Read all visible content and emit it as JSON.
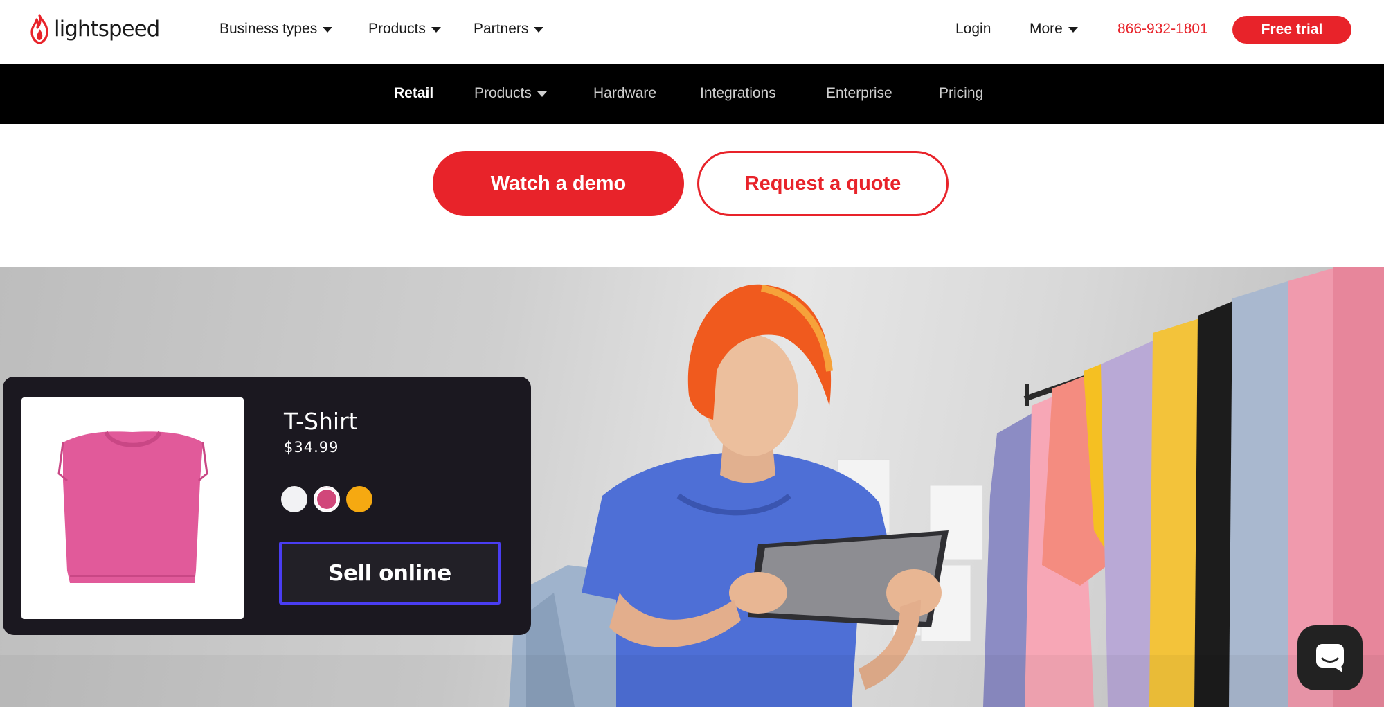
{
  "brand": {
    "name": "lightspeed",
    "color": "#e8232a"
  },
  "topnav": {
    "items": [
      {
        "label": "Business types",
        "dropdown": true
      },
      {
        "label": "Products",
        "dropdown": true
      },
      {
        "label": "Partners",
        "dropdown": true
      }
    ],
    "login": "Login",
    "more": "More",
    "phone": "866-932-1801",
    "trial": "Free trial"
  },
  "subnav": {
    "items": [
      {
        "label": "Retail",
        "active": true
      },
      {
        "label": "Products",
        "dropdown": true
      },
      {
        "label": "Hardware"
      },
      {
        "label": "Integrations"
      },
      {
        "label": "Enterprise"
      },
      {
        "label": "Pricing"
      }
    ]
  },
  "cta": {
    "primary": "Watch a demo",
    "secondary": "Request a quote"
  },
  "product_card": {
    "title": "T-Shirt",
    "price": "$34.99",
    "swatches": [
      "#f2f2f4",
      "#d1477a",
      "#f6a911"
    ],
    "selected_swatch": 1,
    "action": "Sell online"
  },
  "chat": {
    "icon": "chat-bubble-icon"
  }
}
